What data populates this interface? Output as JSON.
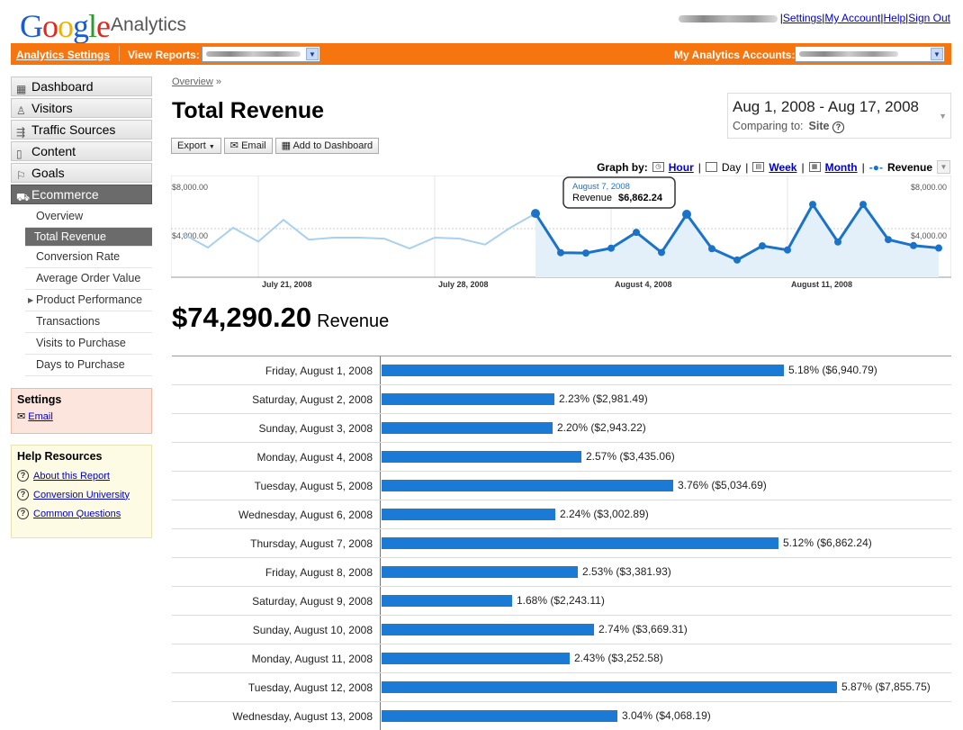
{
  "header": {
    "logo_text": "Google",
    "logo_suffix": "Analytics",
    "links": [
      "Settings",
      "My Account",
      "Help",
      "Sign Out"
    ]
  },
  "orangebar": {
    "settings_link": "Analytics Settings",
    "view_reports_label": "View Reports:",
    "accounts_label": "My Analytics Accounts:"
  },
  "nav": {
    "items": [
      {
        "label": "Dashboard",
        "icon": "dashboard-icon"
      },
      {
        "label": "Visitors",
        "icon": "visitor-icon"
      },
      {
        "label": "Traffic Sources",
        "icon": "traffic-icon"
      },
      {
        "label": "Content",
        "icon": "content-icon"
      },
      {
        "label": "Goals",
        "icon": "flag-icon"
      },
      {
        "label": "Ecommerce",
        "icon": "cart-icon"
      }
    ],
    "sub_items": [
      "Overview",
      "Total Revenue",
      "Conversion Rate",
      "Average Order Value",
      "Product Performance",
      "Transactions",
      "Visits to Purchase",
      "Days to Purchase"
    ]
  },
  "settings_box": {
    "title": "Settings",
    "email": "Email"
  },
  "help_box": {
    "title": "Help Resources",
    "links": [
      "About this Report",
      "Conversion University",
      "Common Questions"
    ]
  },
  "breadcrumb": {
    "link": "Overview",
    "sep": "»"
  },
  "page_title": "Total Revenue",
  "datebox": {
    "range": "Aug 1, 2008 - Aug 17, 2008",
    "compare_label": "Comparing to:",
    "compare_value": "Site"
  },
  "toolbar": {
    "export": "Export",
    "email": "Email",
    "add_dashboard": "Add to Dashboard"
  },
  "graphby": {
    "label": "Graph by:",
    "hour": "Hour",
    "day": "Day",
    "week": "Week",
    "month": "Month",
    "legend": "Revenue"
  },
  "chart_data": {
    "type": "line",
    "ylim": [
      0,
      10000
    ],
    "y_ticks": [
      "$8,000.00",
      "$4,000.00"
    ],
    "x_ticks": [
      "July 21, 2008",
      "July 28, 2008",
      "August 4, 2008",
      "August 11, 2008"
    ],
    "series": [
      {
        "name": "Revenue",
        "values": [
          4900,
          3500,
          5500,
          4100,
          6300,
          4300,
          4500,
          4500,
          4400,
          3400,
          4500,
          4400,
          3800,
          5500,
          6940.79,
          2981.49,
          2943.22,
          3435.06,
          5034.69,
          3002.89,
          6862.24,
          3381.93,
          2243.11,
          3669.31,
          3252.58,
          7855.75,
          4068.19,
          7855.75,
          4300,
          3700,
          3450
        ]
      }
    ],
    "tooltip": {
      "date": "August 7, 2008",
      "label": "Revenue",
      "value": "$6,862.24"
    }
  },
  "total": {
    "amount": "$74,290.20",
    "label": "Revenue"
  },
  "rows": [
    {
      "date": "Friday, August 1, 2008",
      "pct": 5.18,
      "text": "5.18% ($6,940.79)"
    },
    {
      "date": "Saturday, August 2, 2008",
      "pct": 2.23,
      "text": "2.23% ($2,981.49)"
    },
    {
      "date": "Sunday, August 3, 2008",
      "pct": 2.2,
      "text": "2.20% ($2,943.22)"
    },
    {
      "date": "Monday, August 4, 2008",
      "pct": 2.57,
      "text": "2.57% ($3,435.06)"
    },
    {
      "date": "Tuesday, August 5, 2008",
      "pct": 3.76,
      "text": "3.76% ($5,034.69)"
    },
    {
      "date": "Wednesday, August 6, 2008",
      "pct": 2.24,
      "text": "2.24% ($3,002.89)"
    },
    {
      "date": "Thursday, August 7, 2008",
      "pct": 5.12,
      "text": "5.12% ($6,862.24)"
    },
    {
      "date": "Friday, August 8, 2008",
      "pct": 2.53,
      "text": "2.53% ($3,381.93)"
    },
    {
      "date": "Saturday, August 9, 2008",
      "pct": 1.68,
      "text": "1.68% ($2,243.11)"
    },
    {
      "date": "Sunday, August 10, 2008",
      "pct": 2.74,
      "text": "2.74% ($3,669.31)"
    },
    {
      "date": "Monday, August 11, 2008",
      "pct": 2.43,
      "text": "2.43% ($3,252.58)"
    },
    {
      "date": "Tuesday, August 12, 2008",
      "pct": 5.87,
      "text": "5.87% ($7,855.75)"
    },
    {
      "date": "Wednesday, August 13, 2008",
      "pct": 3.04,
      "text": "3.04% ($4,068.19)"
    }
  ],
  "colors": {
    "orange": "#f7750f",
    "bar": "#1a7ad4",
    "line": "#1a73c8",
    "line_prev": "#a9d0ee",
    "area": "#e3eff9"
  }
}
